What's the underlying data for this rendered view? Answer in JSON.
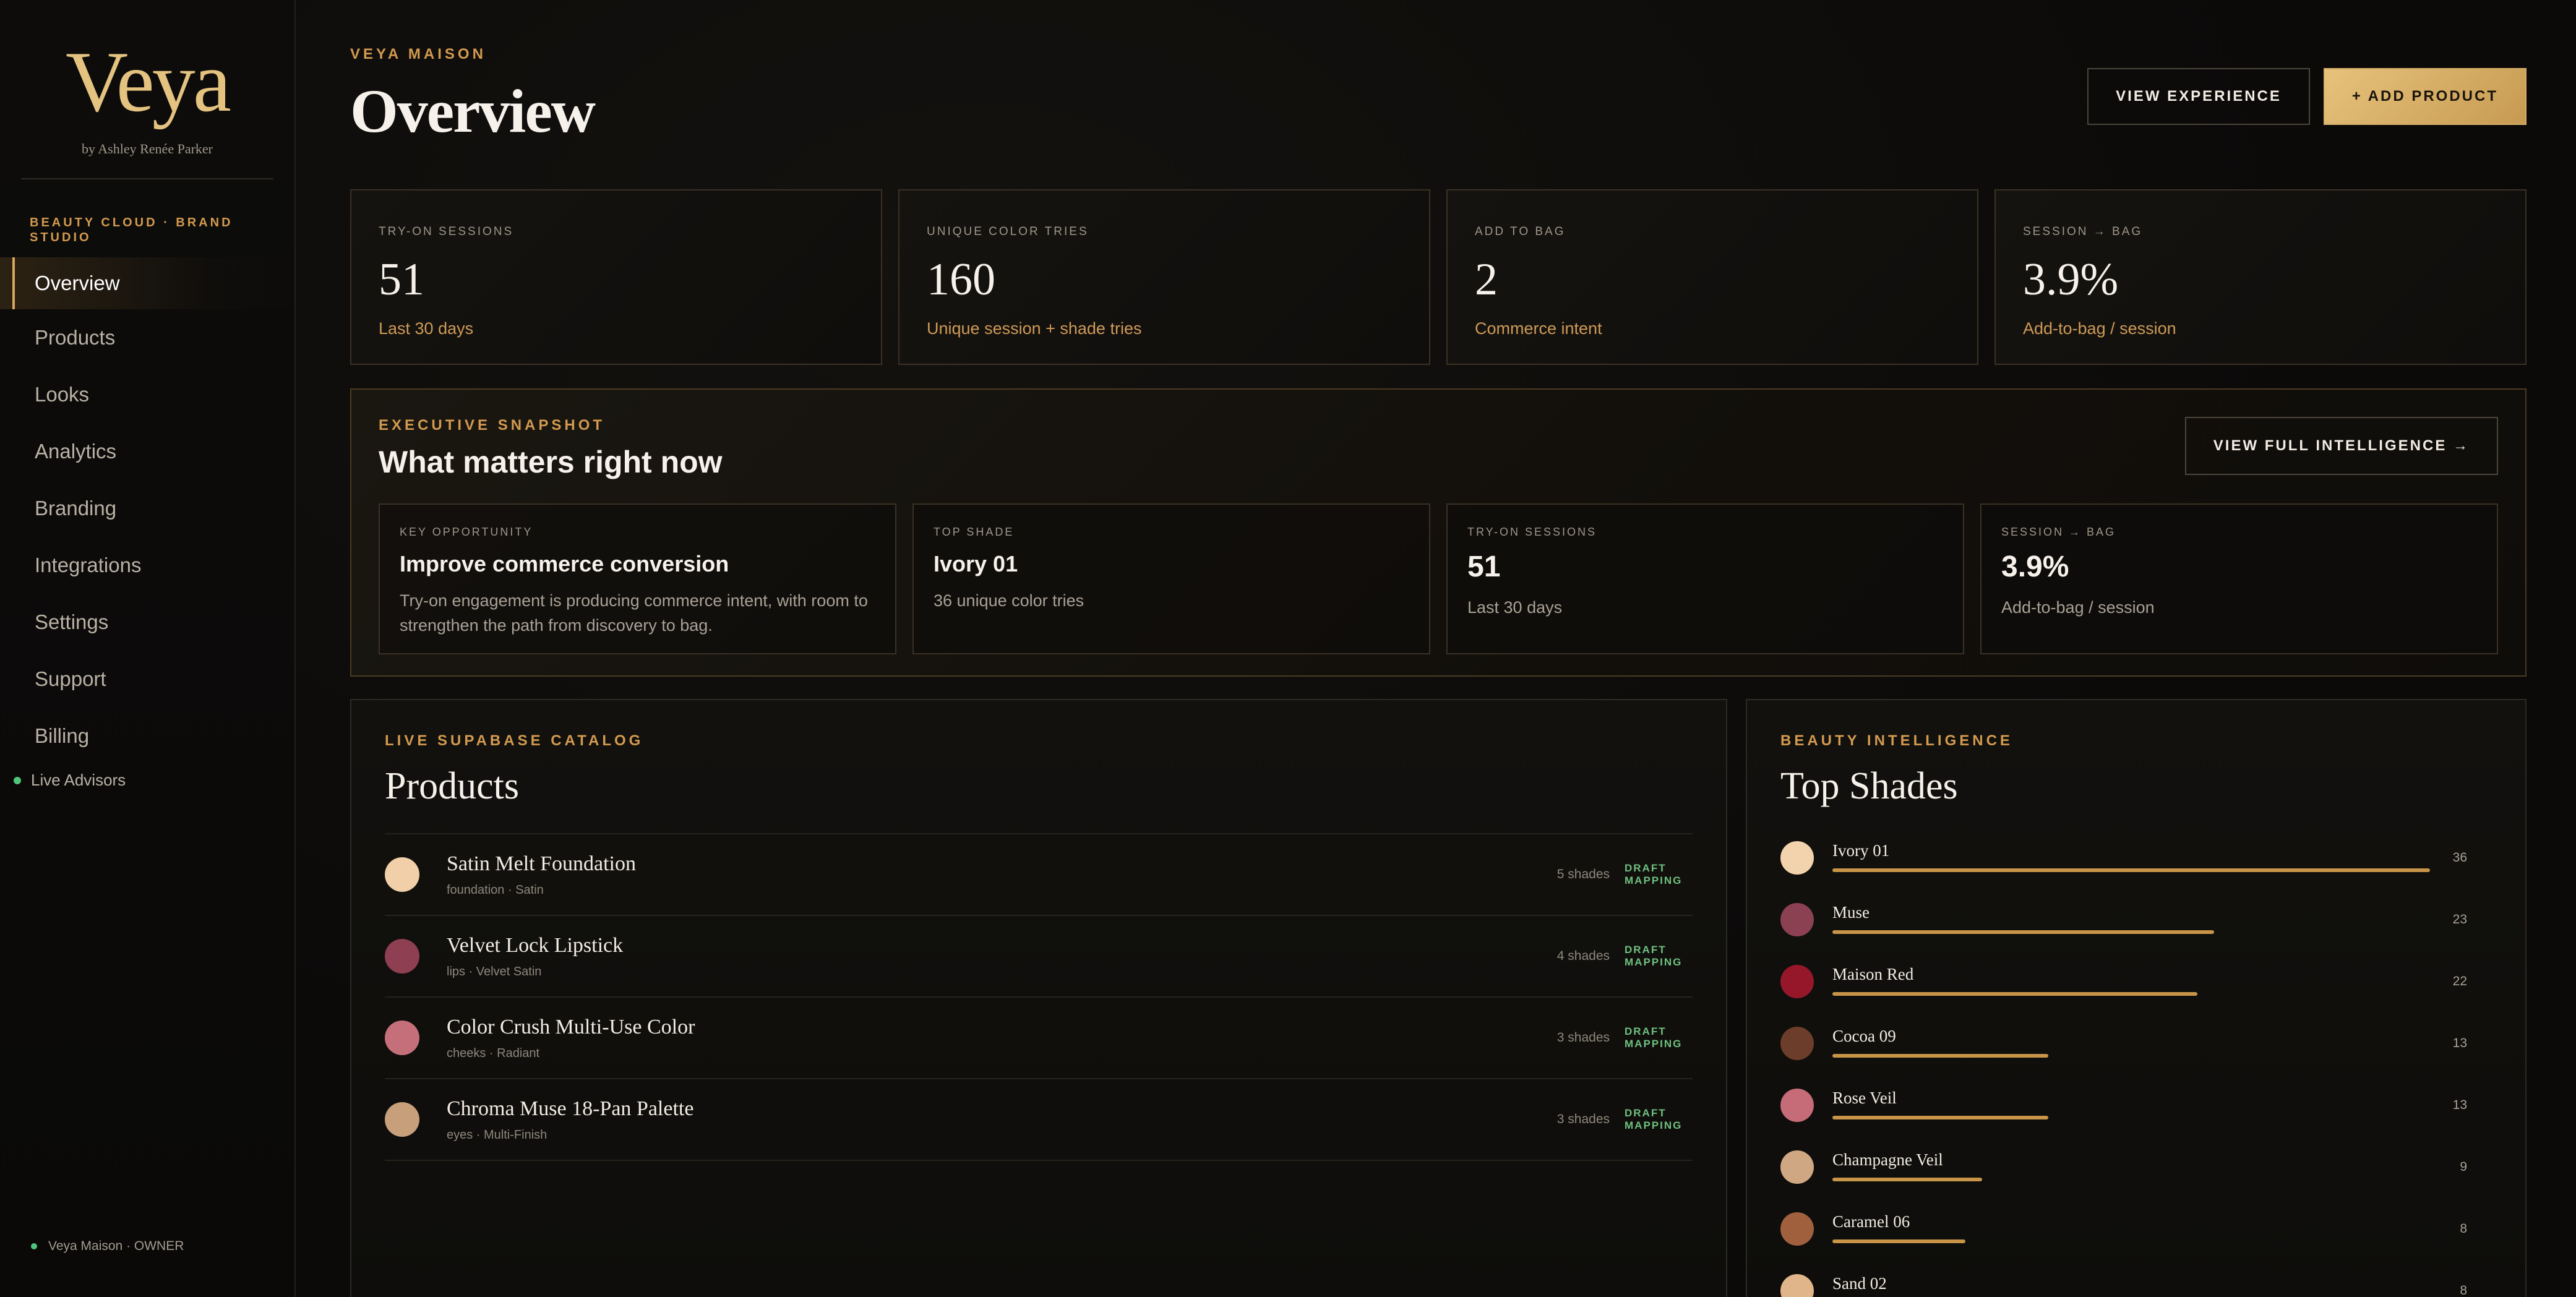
{
  "sidebar": {
    "logo": "Veya",
    "byline": "by Ashley Renée Parker",
    "studio_label": "BEAUTY CLOUD · BRAND STUDIO",
    "nav": [
      {
        "label": "Overview",
        "active": true
      },
      {
        "label": "Products"
      },
      {
        "label": "Looks"
      },
      {
        "label": "Analytics"
      },
      {
        "label": "Branding"
      },
      {
        "label": "Integrations"
      },
      {
        "label": "Settings"
      },
      {
        "label": "Support"
      },
      {
        "label": "Billing"
      }
    ],
    "live_advisors": "Live Advisors",
    "owner": "Veya Maison · OWNER"
  },
  "header": {
    "eyebrow": "VEYA MAISON",
    "title": "Overview",
    "view_experience": "VIEW EXPERIENCE",
    "add_product": "+ ADD PRODUCT"
  },
  "stats": [
    {
      "label": "TRY-ON SESSIONS",
      "value": "51",
      "sub": "Last 30 days"
    },
    {
      "label": "UNIQUE COLOR TRIES",
      "value": "160",
      "sub": "Unique session + shade tries"
    },
    {
      "label": "ADD TO BAG",
      "value": "2",
      "sub": "Commerce intent"
    },
    {
      "label": "SESSION → BAG",
      "value": "3.9%",
      "sub": "Add-to-bag / session"
    }
  ],
  "snapshot": {
    "eyebrow": "EXECUTIVE SNAPSHOT",
    "title": "What matters right now",
    "button": "VIEW FULL INTELLIGENCE →",
    "cards": [
      {
        "label": "KEY OPPORTUNITY",
        "head": "Improve commerce conversion",
        "text": "Try-on engagement is producing commerce intent, with room to strengthen the path from discovery to bag."
      },
      {
        "label": "TOP SHADE",
        "head": "Ivory 01",
        "text": "36 unique color tries"
      },
      {
        "label": "TRY-ON SESSIONS",
        "value": "51",
        "text": "Last 30 days"
      },
      {
        "label": "SESSION → BAG",
        "value": "3.9%",
        "text": "Add-to-bag / session"
      }
    ]
  },
  "products": {
    "eyebrow": "LIVE SUPABASE CATALOG",
    "title": "Products",
    "items": [
      {
        "name": "Satin Melt Foundation",
        "meta": "foundation · Satin",
        "shades": "5 shades",
        "status": "DRAFT MAPPING",
        "color": "#f1cfa8"
      },
      {
        "name": "Velvet Lock Lipstick",
        "meta": "lips · Velvet Satin",
        "shades": "4 shades",
        "status": "DRAFT MAPPING",
        "color": "#8e3f52"
      },
      {
        "name": "Color Crush Multi-Use Color",
        "meta": "cheeks · Radiant",
        "shades": "3 shades",
        "status": "DRAFT MAPPING",
        "color": "#c56f7a"
      },
      {
        "name": "Chroma Muse 18-Pan Palette",
        "meta": "eyes · Multi-Finish",
        "shades": "3 shades",
        "status": "DRAFT MAPPING",
        "color": "#c79f7b"
      }
    ]
  },
  "shades": {
    "eyebrow": "BEAUTY INTELLIGENCE",
    "title": "Top Shades",
    "max": 36,
    "items": [
      {
        "name": "Ivory 01",
        "count": "36",
        "value": 36,
        "color": "#f3d3ae"
      },
      {
        "name": "Muse",
        "count": "23",
        "value": 23,
        "color": "#8c4152"
      },
      {
        "name": "Maison Red",
        "count": "22",
        "value": 22,
        "color": "#96172a"
      },
      {
        "name": "Cocoa 09",
        "count": "13",
        "value": 13,
        "color": "#6b3d2a"
      },
      {
        "name": "Rose Veil",
        "count": "13",
        "value": 13,
        "color": "#c66b78"
      },
      {
        "name": "Champagne Veil",
        "count": "9",
        "value": 9,
        "color": "#cfa883"
      },
      {
        "name": "Caramel 06",
        "count": "8",
        "value": 8,
        "color": "#a0603e"
      },
      {
        "name": "Sand 02",
        "count": "8",
        "value": 8,
        "color": "#e0b589"
      }
    ]
  },
  "colors": {
    "accent_gold": "#d39a4f",
    "status_green": "#6fc07f",
    "bar_gold": "#c89447"
  }
}
